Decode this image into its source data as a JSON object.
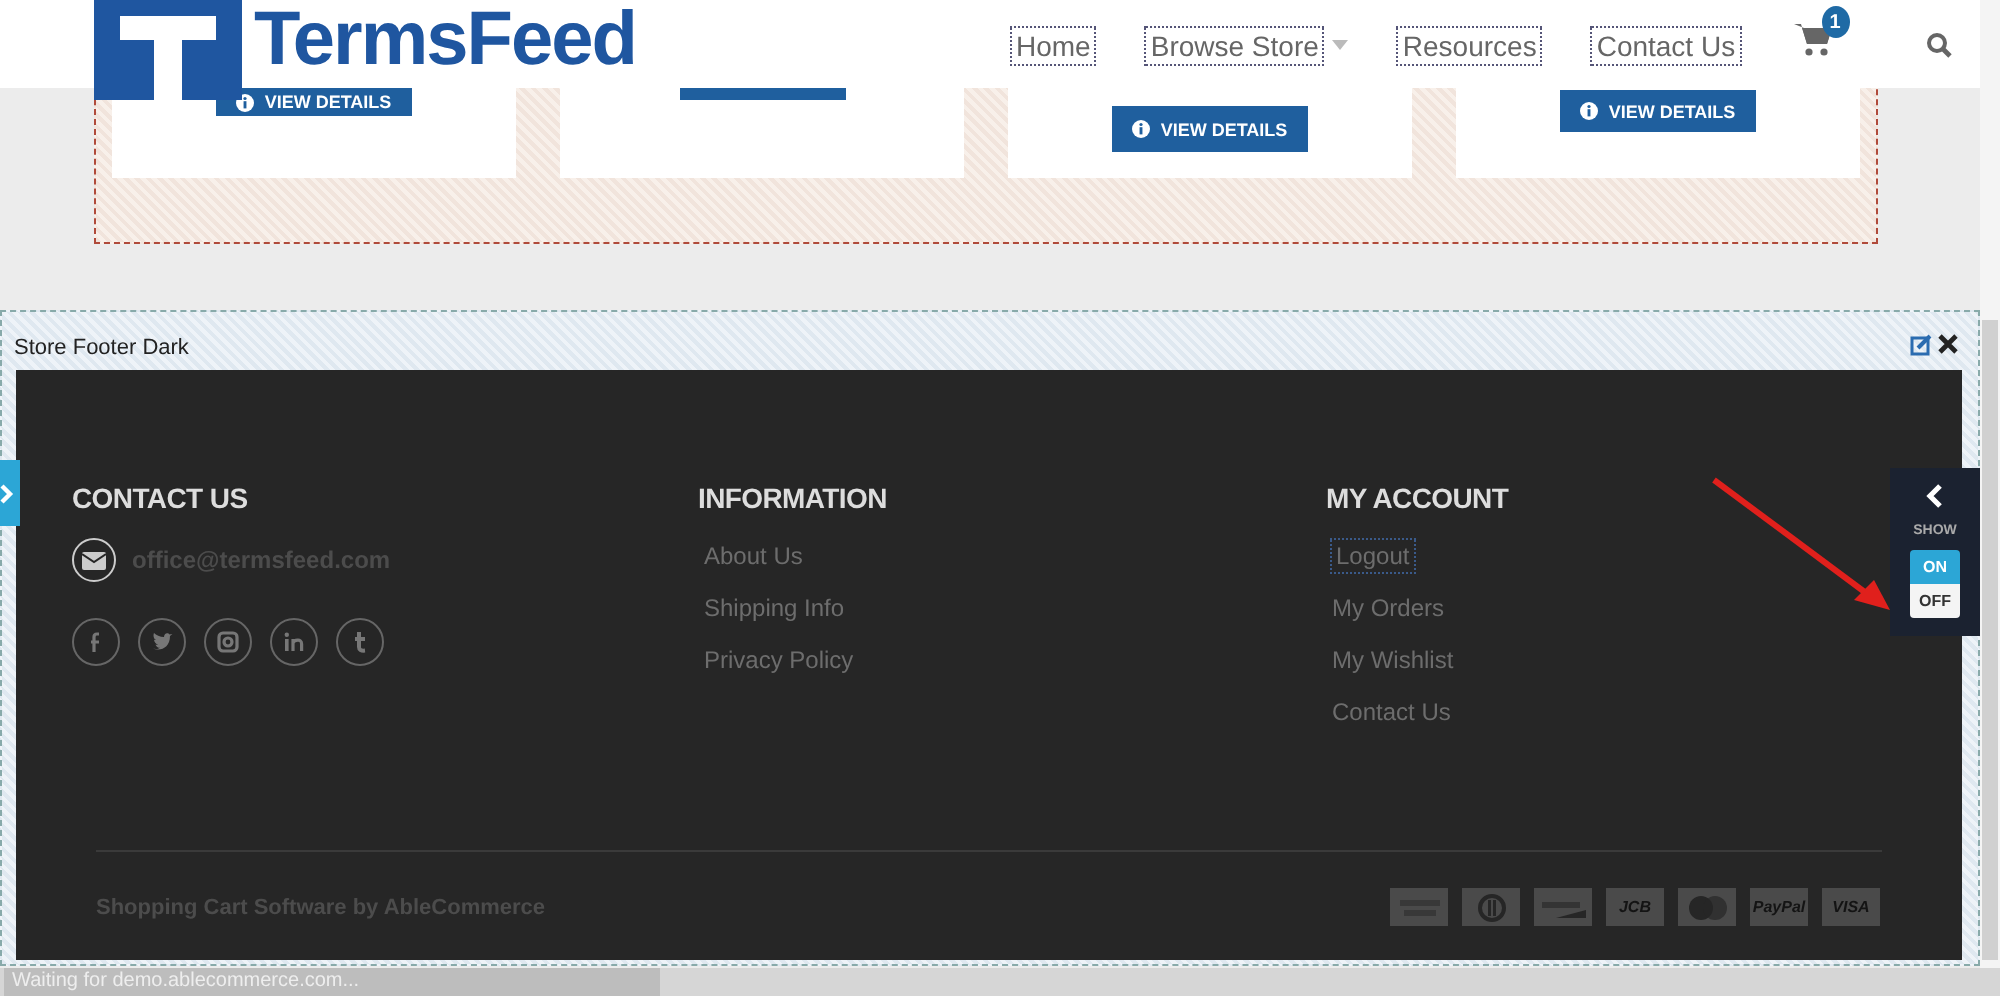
{
  "header": {
    "brand": "TermsFeed",
    "nav": [
      {
        "label": "Home",
        "focused": true,
        "dropdown": false
      },
      {
        "label": "Browse Store",
        "focused": true,
        "dropdown": true
      },
      {
        "label": "Resources",
        "focused": true,
        "dropdown": false
      },
      {
        "label": "Contact Us",
        "focused": true,
        "dropdown": false
      }
    ],
    "cart_count": "1"
  },
  "products": [
    {
      "kind": "button",
      "button_label": "VIEW DETAILS"
    },
    {
      "kind": "button-edge"
    },
    {
      "kind": "button",
      "button_label": "VIEW DETAILS"
    },
    {
      "kind": "button",
      "button_label": "VIEW DETAILS"
    }
  ],
  "widget": {
    "title": "Store Footer Dark"
  },
  "footer": {
    "columns": [
      {
        "heading": "CONTACT US",
        "kind": "contact",
        "email": "office@termsfeed.com",
        "social": [
          {
            "kind": "facebook"
          },
          {
            "kind": "twitter"
          },
          {
            "kind": "instagram"
          },
          {
            "kind": "linkedin"
          },
          {
            "kind": "tumblr"
          }
        ]
      },
      {
        "heading": "INFORMATION",
        "kind": "links",
        "links": [
          {
            "label": "About Us",
            "focused": false
          },
          {
            "label": "Shipping Info",
            "focused": false
          },
          {
            "label": "Privacy Policy",
            "focused": false
          }
        ]
      },
      {
        "heading": "MY ACCOUNT",
        "kind": "links",
        "links": [
          {
            "label": "Logout",
            "focused": true
          },
          {
            "label": "My Orders",
            "focused": false
          },
          {
            "label": "My Wishlist",
            "focused": false
          },
          {
            "label": "Contact Us",
            "focused": false
          }
        ]
      }
    ],
    "credit": "Shopping Cart Software by AbleCommerce",
    "payments": [
      {
        "kind": "drawing"
      },
      {
        "kind": "drawing"
      },
      {
        "kind": "drawing"
      },
      {
        "kind": "text",
        "label": "JCB"
      },
      {
        "kind": "drawing"
      },
      {
        "kind": "text",
        "label": "PayPal"
      },
      {
        "kind": "text",
        "label": "VISA"
      }
    ]
  },
  "show_panel": {
    "label": "SHOW",
    "options": [
      {
        "label": "ON",
        "selected": true
      },
      {
        "label": "OFF",
        "selected": false
      }
    ]
  },
  "status_bar": {
    "text": "Waiting for demo.ablecommerce.com..."
  }
}
